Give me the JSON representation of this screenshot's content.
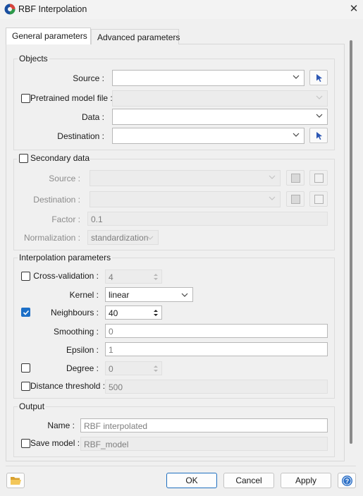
{
  "window": {
    "title": "RBF Interpolation"
  },
  "tabs": [
    {
      "label": "General parameters",
      "active": true
    },
    {
      "label": "Advanced parameters",
      "active": false
    }
  ],
  "objects": {
    "title": "Objects",
    "source_label": "Source :",
    "source_value": "",
    "pretrained_label": "Pretrained model file :",
    "pretrained_checked": false,
    "pretrained_value": "",
    "data_label": "Data :",
    "data_value": "",
    "destination_label": "Destination :",
    "destination_value": ""
  },
  "secondary": {
    "title": "Secondary data",
    "checked": false,
    "source_label": "Source :",
    "destination_label": "Destination :",
    "factor_label": "Factor :",
    "factor_value": "0.1",
    "normalization_label": "Normalization :",
    "normalization_value": "standardization"
  },
  "interpolation": {
    "title": "Interpolation parameters",
    "cross_validation_label": "Cross-validation :",
    "cross_validation_checked": false,
    "cross_validation_value": "4",
    "kernel_label": "Kernel :",
    "kernel_value": "linear",
    "neighbours_label": "Neighbours :",
    "neighbours_checked": true,
    "neighbours_value": "40",
    "smoothing_label": "Smoothing :",
    "smoothing_value": "0",
    "epsilon_label": "Epsilon :",
    "epsilon_value": "1",
    "degree_label": "Degree :",
    "degree_checked": false,
    "degree_value": "0",
    "distance_threshold_label": "Distance threshold :",
    "distance_threshold_checked": false,
    "distance_threshold_value": "500"
  },
  "output": {
    "title": "Output",
    "name_label": "Name :",
    "name_placeholder": "RBF interpolated",
    "save_model_label": "Save model :",
    "save_model_checked": false,
    "save_model_value": "RBF_model"
  },
  "buttons": {
    "ok": "OK",
    "cancel": "Cancel",
    "apply": "Apply"
  },
  "icons": {
    "app": "app-logo-icon",
    "close": "close-icon",
    "picker": "cursor-arrow-icon",
    "folder": "folder-open-icon",
    "help": "help-icon",
    "chevron": "chevron-down-icon"
  },
  "colors": {
    "accent": "#1c6fc7",
    "picker_blue": "#2b56b3",
    "folder_yellow": "#e8b73f"
  }
}
